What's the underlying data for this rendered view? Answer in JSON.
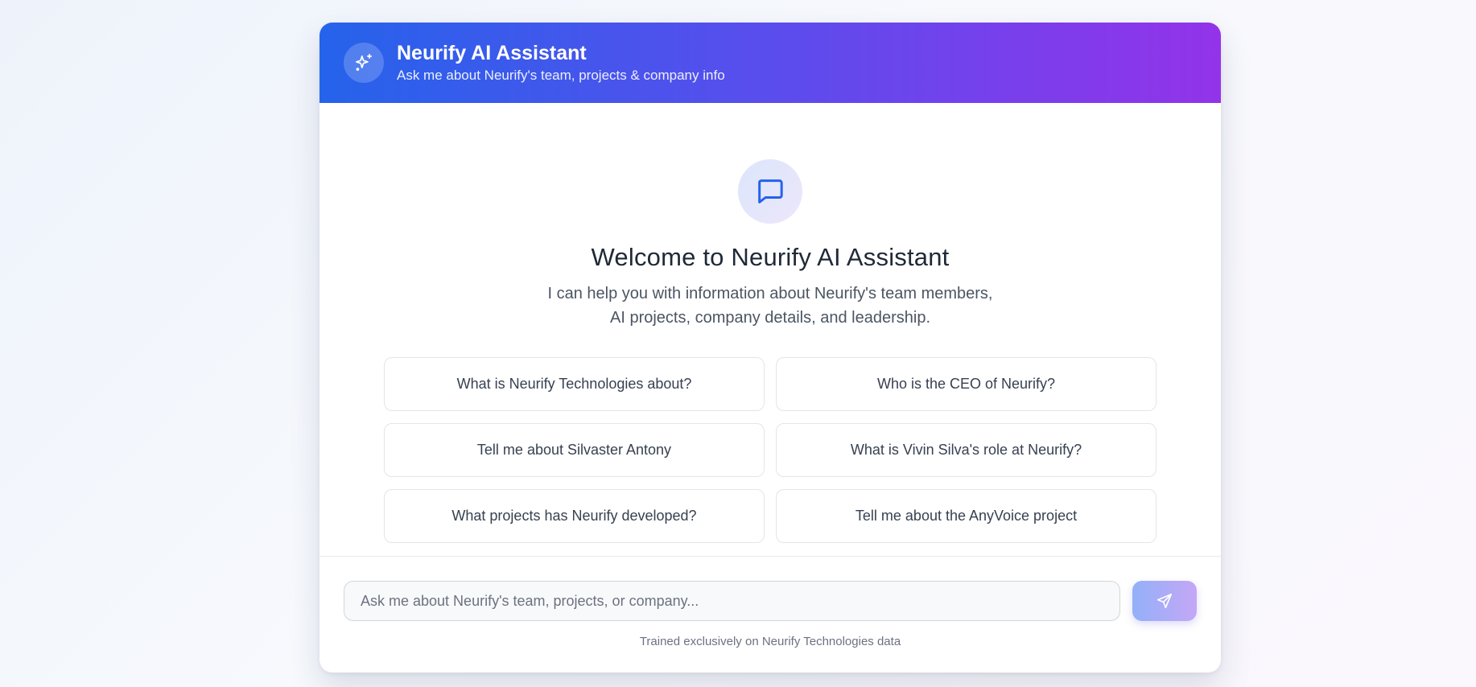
{
  "header": {
    "title": "Neurify AI Assistant",
    "subtitle": "Ask me about Neurify's team, projects & company info",
    "icon": "sparkles-icon"
  },
  "welcome": {
    "icon": "chat-bubble-icon",
    "title": "Welcome to Neurify AI Assistant",
    "description_line1": "I can help you with information about Neurify's team members,",
    "description_line2": "AI projects, company details, and leadership."
  },
  "suggestions": [
    "What is Neurify Technologies about?",
    "Who is the CEO of Neurify?",
    "Tell me about Silvaster Antony",
    "What is Vivin Silva's role at Neurify?",
    "What projects has Neurify developed?",
    "Tell me about the AnyVoice project"
  ],
  "input": {
    "placeholder": "Ask me about Neurify's team, projects, or company...",
    "value": ""
  },
  "send_button": {
    "icon": "send-icon"
  },
  "footer_note": "Trained exclusively on Neurify Technologies data",
  "colors": {
    "header_gradient_start": "#2563eb",
    "header_gradient_end": "#9333ea",
    "icon_blue": "#2563eb"
  }
}
